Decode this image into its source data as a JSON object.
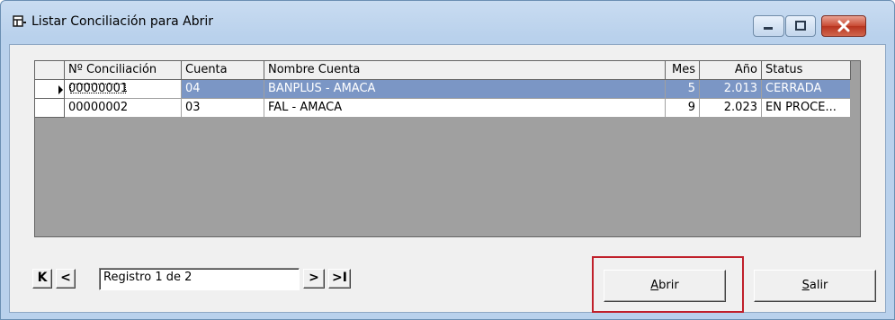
{
  "window": {
    "title": "Listar Conciliación para Abrir",
    "icon": "table-window-icon"
  },
  "grid": {
    "columns": [
      "Nº Conciliación",
      "Cuenta",
      "Nombre Cuenta",
      "Mes",
      "Año",
      "Status"
    ],
    "rows": [
      {
        "conciliacion": "00000001",
        "cuenta": "04",
        "nombre": "BANPLUS - AMACA",
        "mes": "5",
        "anio": "2.013",
        "status": "CERRADA"
      },
      {
        "conciliacion": "00000002",
        "cuenta": "03",
        "nombre": "FAL - AMACA",
        "mes": "9",
        "anio": "2.023",
        "status": "EN PROCE..."
      }
    ],
    "selected_row": 0,
    "selection_color": "#7b96c5"
  },
  "navigator": {
    "first": "K",
    "prev": "<",
    "record": "Registro 1 de 2",
    "next": ">",
    "last": ">I"
  },
  "buttons": {
    "open": "Abrir",
    "exit": "Salir"
  }
}
